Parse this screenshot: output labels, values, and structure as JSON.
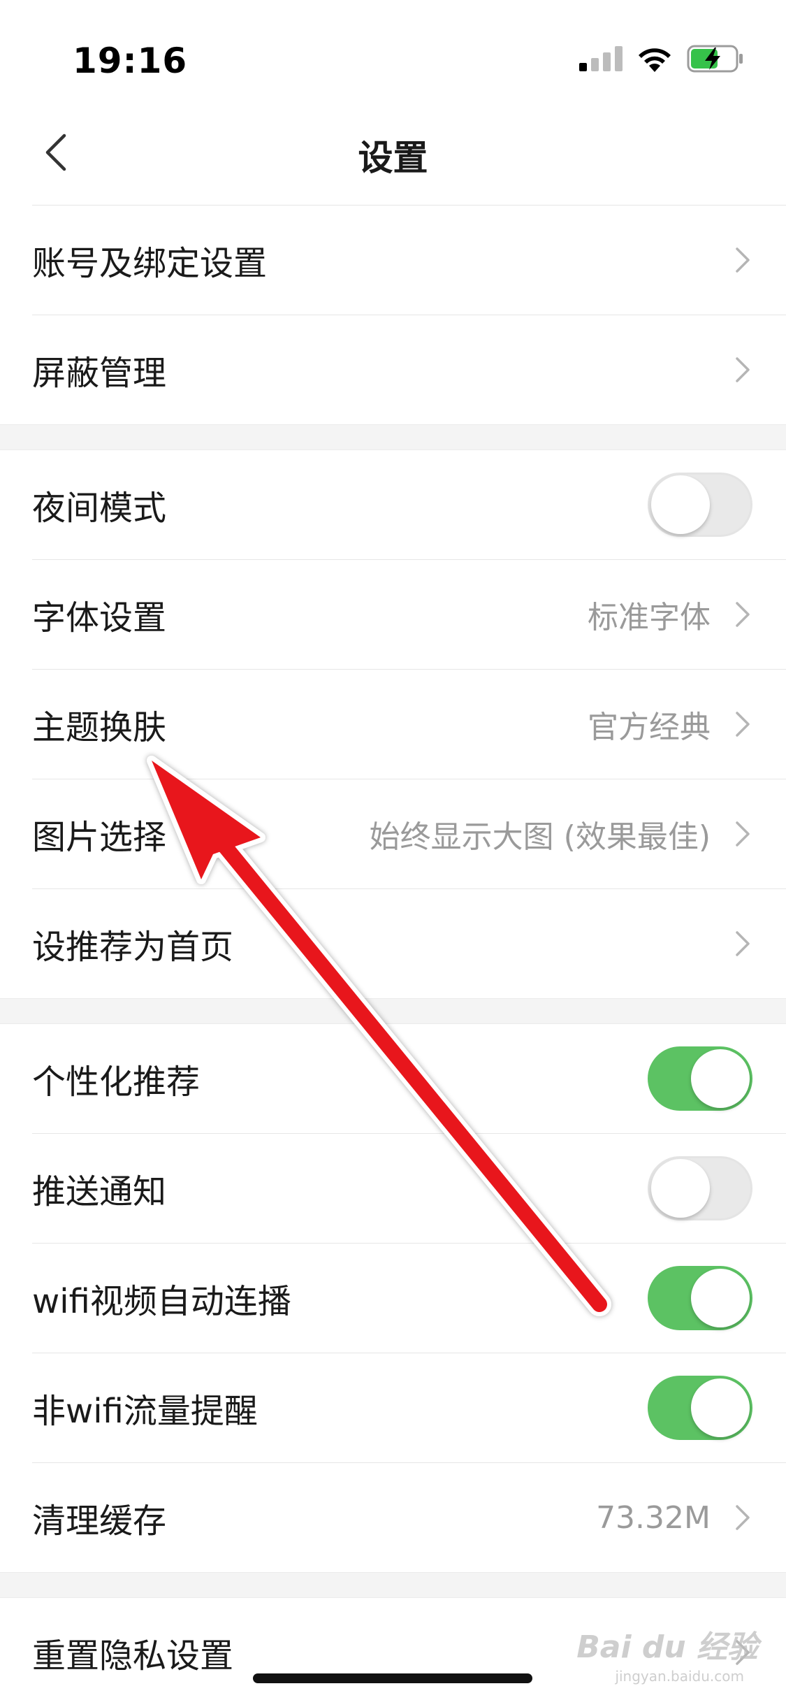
{
  "status_bar": {
    "time": "19:16",
    "icons": [
      "cellular-signal-icon",
      "wifi-icon",
      "battery-charging-icon"
    ]
  },
  "nav": {
    "title": "设置",
    "back_icon": "chevron-left-icon"
  },
  "groups": [
    {
      "items": [
        {
          "label": "账号及绑定设置",
          "type": "link"
        },
        {
          "label": "屏蔽管理",
          "type": "link"
        }
      ]
    },
    {
      "items": [
        {
          "label": "夜间模式",
          "type": "toggle",
          "on": false
        },
        {
          "label": "字体设置",
          "type": "link",
          "value": "标准字体"
        },
        {
          "label": "主题换肤",
          "type": "link",
          "value": "官方经典"
        },
        {
          "label": "图片选择",
          "type": "link",
          "value": "始终显示大图 (效果最佳)"
        },
        {
          "label": "设推荐为首页",
          "type": "link"
        }
      ]
    },
    {
      "items": [
        {
          "label": "个性化推荐",
          "type": "toggle",
          "on": true
        },
        {
          "label": "推送通知",
          "type": "toggle",
          "on": false
        },
        {
          "label": "wifi视频自动连播",
          "type": "toggle",
          "on": true
        },
        {
          "label": "非wifi流量提醒",
          "type": "toggle",
          "on": true
        },
        {
          "label": "清理缓存",
          "type": "link",
          "value": "73.32M"
        }
      ]
    },
    {
      "items": [
        {
          "label": "重置隐私设置",
          "type": "link"
        }
      ]
    }
  ],
  "watermark": {
    "brand": "Bai du 经验",
    "site": "jingyan.baidu.com"
  },
  "colors": {
    "toggle_on": "#5cc263",
    "toggle_off": "#e9e9e9",
    "value_text": "#9a9a9a",
    "annotation_arrow": "#e8141c"
  }
}
